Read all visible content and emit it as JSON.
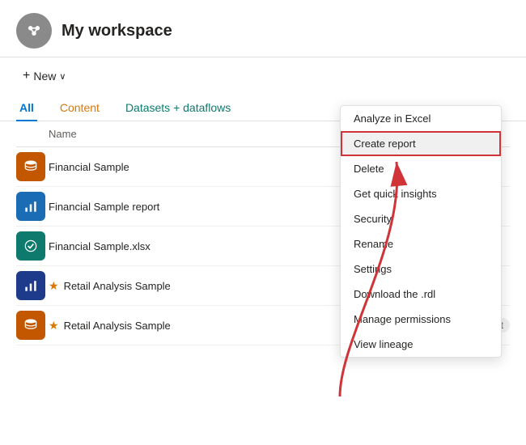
{
  "header": {
    "title": "My workspace"
  },
  "toolbar": {
    "new_label": "New",
    "new_label_plus": "+",
    "new_chevron": "∨"
  },
  "tabs": [
    {
      "label": "All",
      "state": "active"
    },
    {
      "label": "Content",
      "state": "orange"
    },
    {
      "label": "Datasets + dataflows",
      "state": "teal"
    }
  ],
  "table": {
    "col_name": "Name"
  },
  "rows": [
    {
      "name": "Financial Sample",
      "icon_type": "database",
      "color": "orange",
      "has_star": false
    },
    {
      "name": "Financial Sample report",
      "icon_type": "chart",
      "color": "blue",
      "has_star": false
    },
    {
      "name": "Financial Sample.xlsx",
      "icon_type": "circle-check",
      "color": "teal",
      "has_star": false
    },
    {
      "name": "Retail Analysis Sample",
      "icon_type": "chart",
      "color": "darkblue",
      "has_star": true
    },
    {
      "name": "Retail Analysis Sample",
      "icon_type": "database",
      "color": "orange",
      "badge": "Dataset",
      "has_star": true,
      "show_actions": true
    }
  ],
  "context_menu": {
    "items": [
      {
        "label": "Analyze in Excel",
        "highlighted": false
      },
      {
        "label": "Create report",
        "highlighted": true
      },
      {
        "label": "Delete",
        "highlighted": false
      },
      {
        "label": "Get quick insights",
        "highlighted": false
      },
      {
        "label": "Security",
        "highlighted": false
      },
      {
        "label": "Rename",
        "highlighted": false
      },
      {
        "label": "Settings",
        "highlighted": false
      },
      {
        "label": "Download the .rdl",
        "highlighted": false
      },
      {
        "label": "Manage permissions",
        "highlighted": false
      },
      {
        "label": "View lineage",
        "highlighted": false
      }
    ]
  }
}
